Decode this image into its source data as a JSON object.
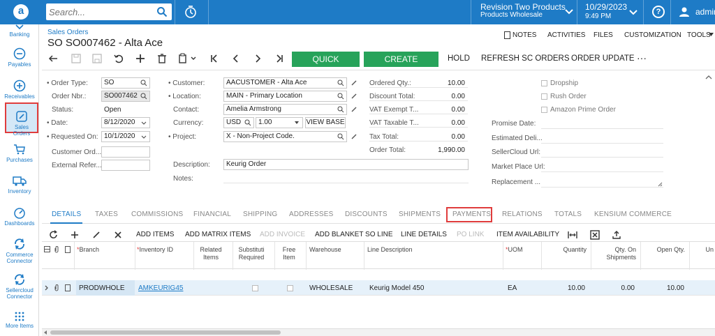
{
  "topbar": {
    "search_placeholder": "Search...",
    "company_name": "Revision Two Products",
    "company_sub": "Products Wholesale",
    "date": "10/29/2023",
    "time": "9:49 PM",
    "help": "?",
    "user": "admin",
    "brand_color": "#1e7bc6"
  },
  "nav": [
    {
      "label": "Banking",
      "icon": "banking-icon"
    },
    {
      "label": "Payables",
      "icon": "minus-circle-icon"
    },
    {
      "label": "Receivables",
      "icon": "plus-circle-icon"
    },
    {
      "label": "Sales Orders",
      "icon": "pencil-square-icon"
    },
    {
      "label": "Purchases",
      "icon": "cart-icon"
    },
    {
      "label": "Inventory",
      "icon": "truck-icon"
    },
    {
      "label": "Dashboards",
      "icon": "gauge-icon"
    },
    {
      "label": "Commerce Connector",
      "label_lines": [
        "Commerce",
        "Connector"
      ],
      "icon": "sync-icon"
    },
    {
      "label": "Sellercloud Connector",
      "label_lines": [
        "Sellercloud",
        "Connector"
      ],
      "icon": "sync-icon"
    },
    {
      "label": "More Items",
      "icon": "grid-dots-icon"
    }
  ],
  "header": {
    "breadcrumb": "Sales Orders",
    "title": "SO SO007462 - Alta Ace",
    "links": [
      "NOTES",
      "ACTIVITIES",
      "FILES",
      "CUSTOMIZATION",
      "TOOLS"
    ]
  },
  "toolbar": {
    "quick_process": "QUICK PROCESS",
    "create_shipment": "CREATE SHIPMENT",
    "hold": "HOLD",
    "refresh_sc": "REFRESH SC ORDERS",
    "order_update": "ORDER UPDATE",
    "more": "···",
    "accent_green": "#27a35a"
  },
  "form": {
    "order_type_label": "Order Type:",
    "order_type": "SO",
    "order_nbr_label": "Order Nbr.:",
    "order_nbr": "SO007462",
    "status_label": "Status:",
    "status": "Open",
    "date_label": "Date:",
    "date": "8/12/2020",
    "requested_on_label": "Requested On:",
    "requested_on": "10/1/2020",
    "customer_ord_label": "Customer Ord...",
    "external_refer_label": "External Refer...",
    "customer_label": "Customer:",
    "customer": "AACUSTOMER - Alta Ace",
    "location_label": "Location:",
    "location": "MAIN - Primary Location",
    "contact_label": "Contact:",
    "contact": "Amelia Armstrong",
    "currency_label": "Currency:",
    "currency": "USD",
    "currency_rate": "1.00",
    "view_base": "VIEW BASE",
    "project_label": "Project:",
    "project": "X - Non-Project Code.",
    "description_label": "Description:",
    "description": "Keurig Order",
    "notes_label": "Notes:",
    "totals": [
      {
        "label": "Ordered Qty.:",
        "value": "10.00"
      },
      {
        "label": "Discount Total:",
        "value": "0.00"
      },
      {
        "label": "VAT Exempt T...",
        "value": "0.00"
      },
      {
        "label": "VAT Taxable T...",
        "value": "0.00"
      },
      {
        "label": "Tax Total:",
        "value": "0.00"
      },
      {
        "label": "Order Total:",
        "value": "1,990.00"
      }
    ],
    "checkboxes": [
      "Dropship",
      "Rush Order",
      "Amazon Prime Order"
    ],
    "right_labels": [
      "Promise Date:",
      "Estimated Deli...",
      "SellerCloud Url:",
      "Market Place Url:",
      "Replacement ..."
    ]
  },
  "tabs": [
    "DETAILS",
    "TAXES",
    "COMMISSIONS",
    "FINANCIAL",
    "SHIPPING",
    "ADDRESSES",
    "DISCOUNTS",
    "SHIPMENTS",
    "PAYMENTS",
    "RELATIONS",
    "TOTALS",
    "KENSIUM COMMERCE"
  ],
  "grid_toolbar": {
    "add_items": "ADD ITEMS",
    "add_matrix": "ADD MATRIX ITEMS",
    "add_invoice": "ADD INVOICE",
    "add_blanket": "ADD BLANKET SO LINE",
    "line_details": "LINE DETAILS",
    "po_link": "PO LINK",
    "item_availability": "ITEM AVAILABILITY"
  },
  "grid": {
    "headers": {
      "branch": "Branch",
      "inventory_id": "Inventory ID",
      "related_items": [
        "Related",
        "Items"
      ],
      "substitution": [
        "Substituti",
        "Required"
      ],
      "free_item": [
        "Free",
        "Item"
      ],
      "warehouse": "Warehouse",
      "line_description": "Line Description",
      "uom": "UOM",
      "quantity": "Quantity",
      "qty_on_shipments": [
        "Qty. On",
        "Shipments"
      ],
      "open_qty": "Open Qty.",
      "unit": "Un"
    },
    "rows": [
      {
        "branch": "PRODWHOLE",
        "inventory_id": "AMKEURIG45",
        "warehouse": "WHOLESALE",
        "line_description": "Keurig Model 450",
        "uom": "EA",
        "quantity": "10.00",
        "qty_on_shipments": "0.00",
        "open_qty": "10.00"
      }
    ]
  }
}
